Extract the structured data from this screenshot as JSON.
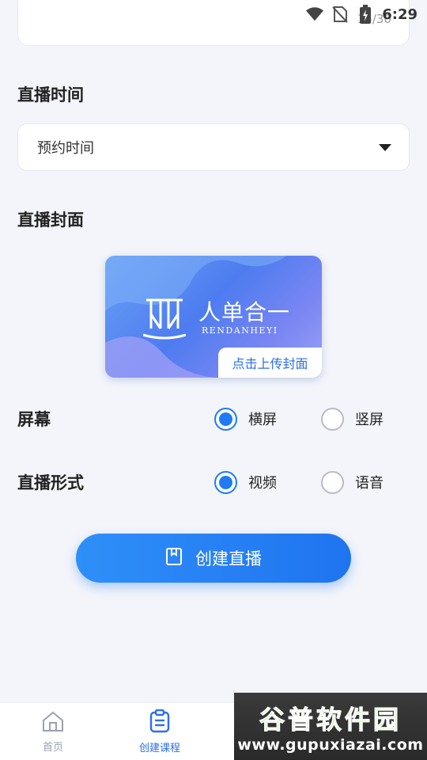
{
  "status_bar": {
    "time": "6:29",
    "icons": [
      "wifi-icon",
      "no-sim-icon",
      "battery-charging-icon"
    ]
  },
  "title_field": {
    "char_count": "15/30"
  },
  "live_time": {
    "label": "直播时间",
    "select_value": "预约时间",
    "caret_icon": "caret-down-icon"
  },
  "cover": {
    "label": "直播封面",
    "brand_cn": "人单合一",
    "brand_en": "RENDANHEYI",
    "upload_label": "点击上传封面"
  },
  "screen": {
    "label": "屏幕",
    "options": [
      {
        "label": "横屏",
        "checked": true
      },
      {
        "label": "竖屏",
        "checked": false
      }
    ]
  },
  "live_format": {
    "label": "直播形式",
    "options": [
      {
        "label": "视频",
        "checked": true
      },
      {
        "label": "语音",
        "checked": false
      }
    ]
  },
  "create_button": {
    "label": "创建直播",
    "icon": "bookmark-icon"
  },
  "tabbar": {
    "tabs": [
      {
        "label": "首页",
        "icon": "home-icon",
        "active": false
      },
      {
        "label": "创建课程",
        "icon": "clipboard-icon",
        "active": true
      }
    ]
  },
  "watermark": {
    "cn": "谷普软件园",
    "en": "www.gupuxiazai.com"
  },
  "colors": {
    "accent": "#1e7bf2",
    "background": "#f3f5fa",
    "tab_active": "#2b6fe8"
  }
}
